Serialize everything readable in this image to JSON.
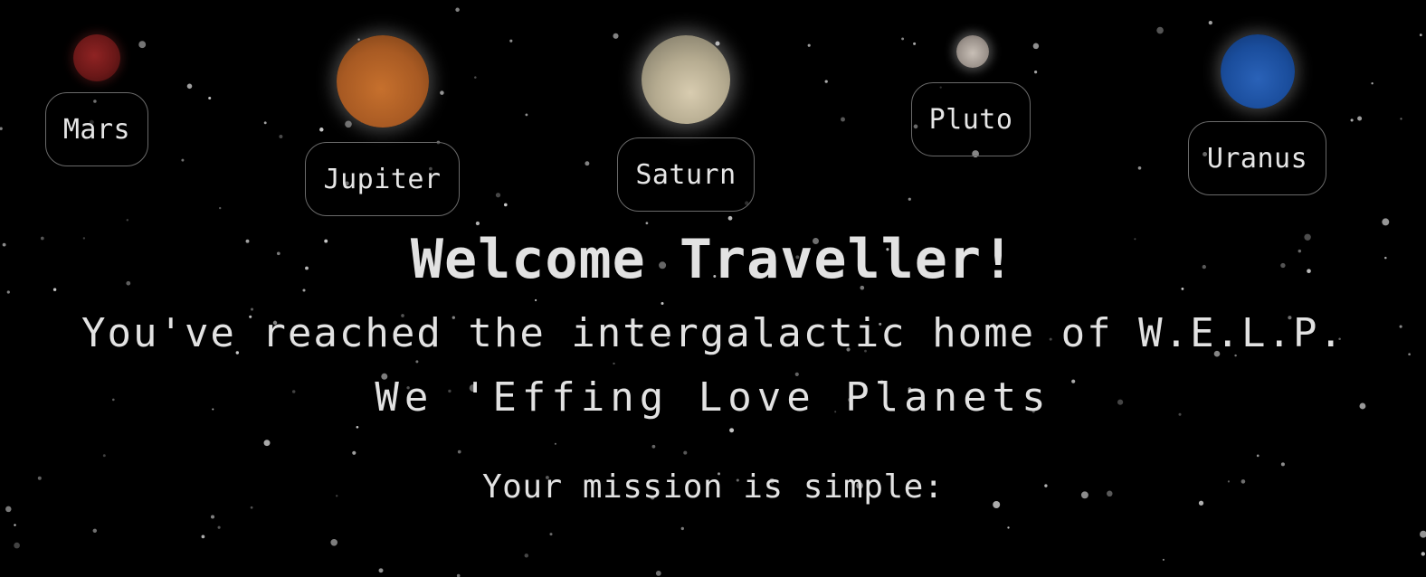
{
  "planets": {
    "mars": {
      "label": "Mars",
      "color": "#7a1c1c"
    },
    "jupiter": {
      "label": "Jupiter",
      "color": "#b8642a"
    },
    "saturn": {
      "label": "Saturn",
      "color": "#cfc4a8"
    },
    "pluto": {
      "label": "Pluto",
      "color": "#b3aaa2"
    },
    "uranus": {
      "label": "Uranus",
      "color": "#1f56a8"
    }
  },
  "hero": {
    "heading": "Welcome Traveller!",
    "line1": "You've reached the intergalactic home of W.E.L.P.",
    "line2": "We 'Effing Love Planets",
    "mission": "Your mission is simple:"
  },
  "theme": {
    "background": "#000000",
    "text": "#e2e2e2",
    "label_border": "#6a6a6a"
  }
}
